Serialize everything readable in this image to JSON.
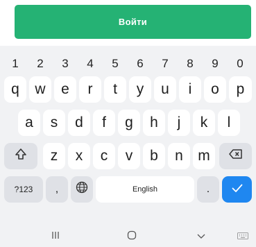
{
  "login_button": {
    "label": "Войти"
  },
  "colors": {
    "accent": "#25b274",
    "enter_key": "#1f87f0",
    "keyboard_bg": "#f1f2f4"
  },
  "keyboard": {
    "numbers": [
      "1",
      "2",
      "3",
      "4",
      "5",
      "6",
      "7",
      "8",
      "9",
      "0"
    ],
    "row1": [
      "q",
      "w",
      "e",
      "r",
      "t",
      "y",
      "u",
      "i",
      "o",
      "p"
    ],
    "row2": [
      "a",
      "s",
      "d",
      "f",
      "g",
      "h",
      "j",
      "k",
      "l"
    ],
    "row3": [
      "z",
      "x",
      "c",
      "v",
      "b",
      "n",
      "m"
    ],
    "symbols_label": "?123",
    "comma_label": ",",
    "space_label": "English",
    "period_label": "."
  },
  "icons": {
    "shift": "shift-icon",
    "backspace": "backspace-icon",
    "globe": "globe-icon",
    "enter": "checkmark-icon",
    "nav_recents": "recents-icon",
    "nav_home": "home-icon",
    "nav_back": "chevron-down-icon",
    "nav_keyboard": "keyboard-icon"
  }
}
